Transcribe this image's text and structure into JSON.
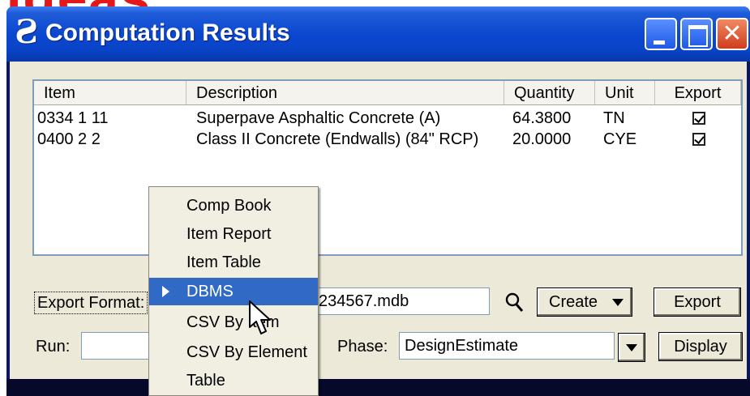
{
  "overlay": {
    "text": "Ideas"
  },
  "window": {
    "title": "Computation Results",
    "app_icon_glyph": "Ƨ",
    "buttons": {
      "minimize": "minimize",
      "maximize": "maximize",
      "close": "✕"
    }
  },
  "table": {
    "columns": [
      "Item",
      "Description",
      "Quantity",
      "Unit",
      "Export"
    ],
    "rows": [
      {
        "item": "0334  1 11",
        "description": "Superpave Asphaltic Concrete (A)",
        "quantity": "64.3800",
        "unit": "TN",
        "export": true
      },
      {
        "item": "0400  2  2",
        "description": "Class II Concrete (Endwalls) (84\" RCP)",
        "quantity": "20.0000",
        "unit": "CYE",
        "export": true
      }
    ]
  },
  "export_format": {
    "label": "Export Format:",
    "file_value": "234567.mdb",
    "create_label": "Create",
    "export_button": "Export"
  },
  "run": {
    "label": "Run:",
    "value": ""
  },
  "phase": {
    "label": "Phase:",
    "value": "DesignEstimate",
    "display_button": "Display"
  },
  "menu": {
    "items": [
      "Comp Book",
      "Item Report",
      "Item Table",
      "DBMS",
      "CSV By Item",
      "CSV By Element",
      "Table"
    ],
    "selected_index": 3
  },
  "colors": {
    "overlay_red": "#e41818",
    "titlebar_blue": "#0b48d0",
    "menu_highlight": "#316ac5",
    "dialog_face": "#ece9d8"
  },
  "icons": {
    "app": "bentley-icon",
    "search": "magnifier-icon",
    "dropdown": "triangle-down-icon",
    "checkbox": "checkbox-checked-icon",
    "cursor": "arrow-cursor-icon"
  }
}
